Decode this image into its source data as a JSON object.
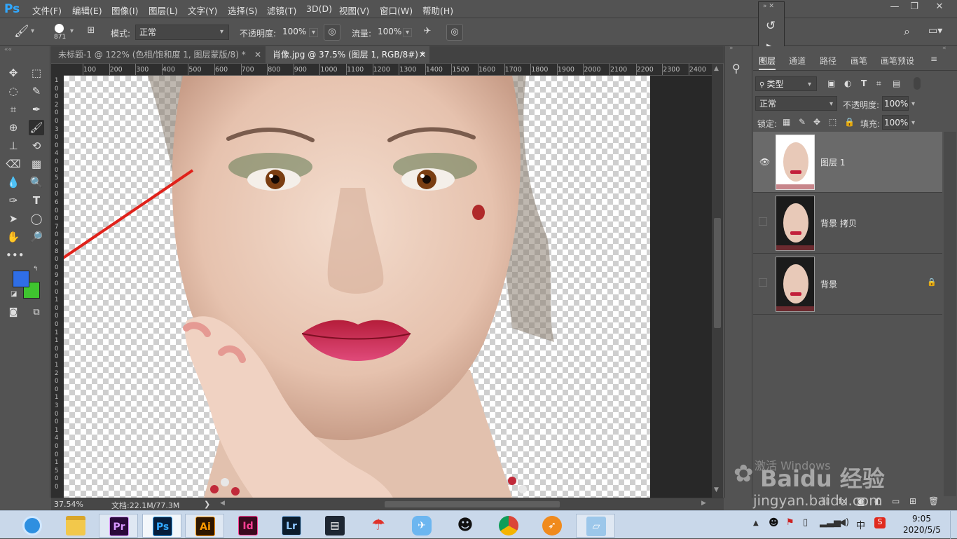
{
  "app": {
    "logo": "Ps"
  },
  "menu": [
    "文件(F)",
    "编辑(E)",
    "图像(I)",
    "图层(L)",
    "文字(Y)",
    "选择(S)",
    "滤镜(T)",
    "3D(D)",
    "视图(V)",
    "窗口(W)",
    "帮助(H)"
  ],
  "window_buttons": [
    "—",
    "❐",
    "✕"
  ],
  "options": {
    "brush_size": "871",
    "mode_label": "模式:",
    "mode_value": "正常",
    "opacity_label": "不透明度:",
    "opacity_value": "100%",
    "flow_label": "流量:",
    "flow_value": "100%"
  },
  "tabs": [
    {
      "label": "未标题-1 @ 122% (色相/饱和度 1, 图层蒙版/8) *",
      "close": "✕",
      "active": false
    },
    {
      "label": "肖像.jpg @ 37.5% (图层 1, RGB/8#) *",
      "close": "✕",
      "active": true
    }
  ],
  "ruler_top": [
    "100",
    "200",
    "300",
    "400",
    "500",
    "600",
    "700",
    "800",
    "900",
    "1000",
    "1100",
    "1200",
    "1300",
    "1400",
    "1500",
    "1600",
    "1700",
    "1800",
    "1900",
    "2000",
    "2100",
    "2200",
    "2300",
    "2400"
  ],
  "ruler_left": [
    "1",
    "0",
    "0",
    "2",
    "0",
    "0",
    "3",
    "0",
    "0",
    "4",
    "0",
    "0",
    "5",
    "0",
    "0",
    "6",
    "0",
    "0",
    "7",
    "0",
    "0",
    "8",
    "0",
    "0",
    "9",
    "0",
    "0",
    "1",
    "0",
    "0",
    "0",
    "1",
    "1",
    "0",
    "0",
    "1",
    "2",
    "0",
    "0",
    "1",
    "3",
    "0",
    "0",
    "1",
    "4",
    "0",
    "0",
    "1",
    "5",
    "0",
    "0"
  ],
  "status": {
    "zoom": "37.54%",
    "doc": "文档:22.1M/77.3M",
    "arrow": "❯"
  },
  "colors": {
    "foreground": "#2f6ee6",
    "background": "#3fc42f",
    "arrow": "#e0211a"
  },
  "panel_tabs": [
    "图层",
    "通道",
    "路径",
    "画笔",
    "画笔预设"
  ],
  "layers_panel": {
    "filter_kind": "类型",
    "blend_mode": "正常",
    "opacity_label": "不透明度:",
    "opacity_value": "100%",
    "lock_label": "锁定:",
    "fill_label": "填充:",
    "fill_value": "100%"
  },
  "layers": [
    {
      "name": "图层 1",
      "visible": true,
      "selected": true,
      "locked": false
    },
    {
      "name": "背景 拷贝",
      "visible": false,
      "selected": false,
      "locked": false
    },
    {
      "name": "背景",
      "visible": false,
      "selected": false,
      "locked": true
    }
  ],
  "watermark": {
    "activate": "激活 Windows",
    "brand": "Baidu 经验",
    "url": "jingyan.baidu.com"
  },
  "taskbar": {
    "apps": [
      {
        "name": "browser",
        "label": ""
      },
      {
        "name": "explorer",
        "label": ""
      },
      {
        "name": "premiere",
        "label": "Pr"
      },
      {
        "name": "photoshop",
        "label": "Ps"
      },
      {
        "name": "illustrator",
        "label": "Ai"
      },
      {
        "name": "indesign",
        "label": "Id"
      },
      {
        "name": "lightroom",
        "label": "Lr"
      },
      {
        "name": "video",
        "label": ""
      },
      {
        "name": "app-umbrella",
        "label": ""
      },
      {
        "name": "app-bird",
        "label": ""
      },
      {
        "name": "qq",
        "label": ""
      },
      {
        "name": "chrome",
        "label": ""
      },
      {
        "name": "app-fox",
        "label": ""
      },
      {
        "name": "app-notebook",
        "label": ""
      }
    ],
    "tray_ime": "中",
    "time": "9:05",
    "date": "2020/5/5"
  }
}
